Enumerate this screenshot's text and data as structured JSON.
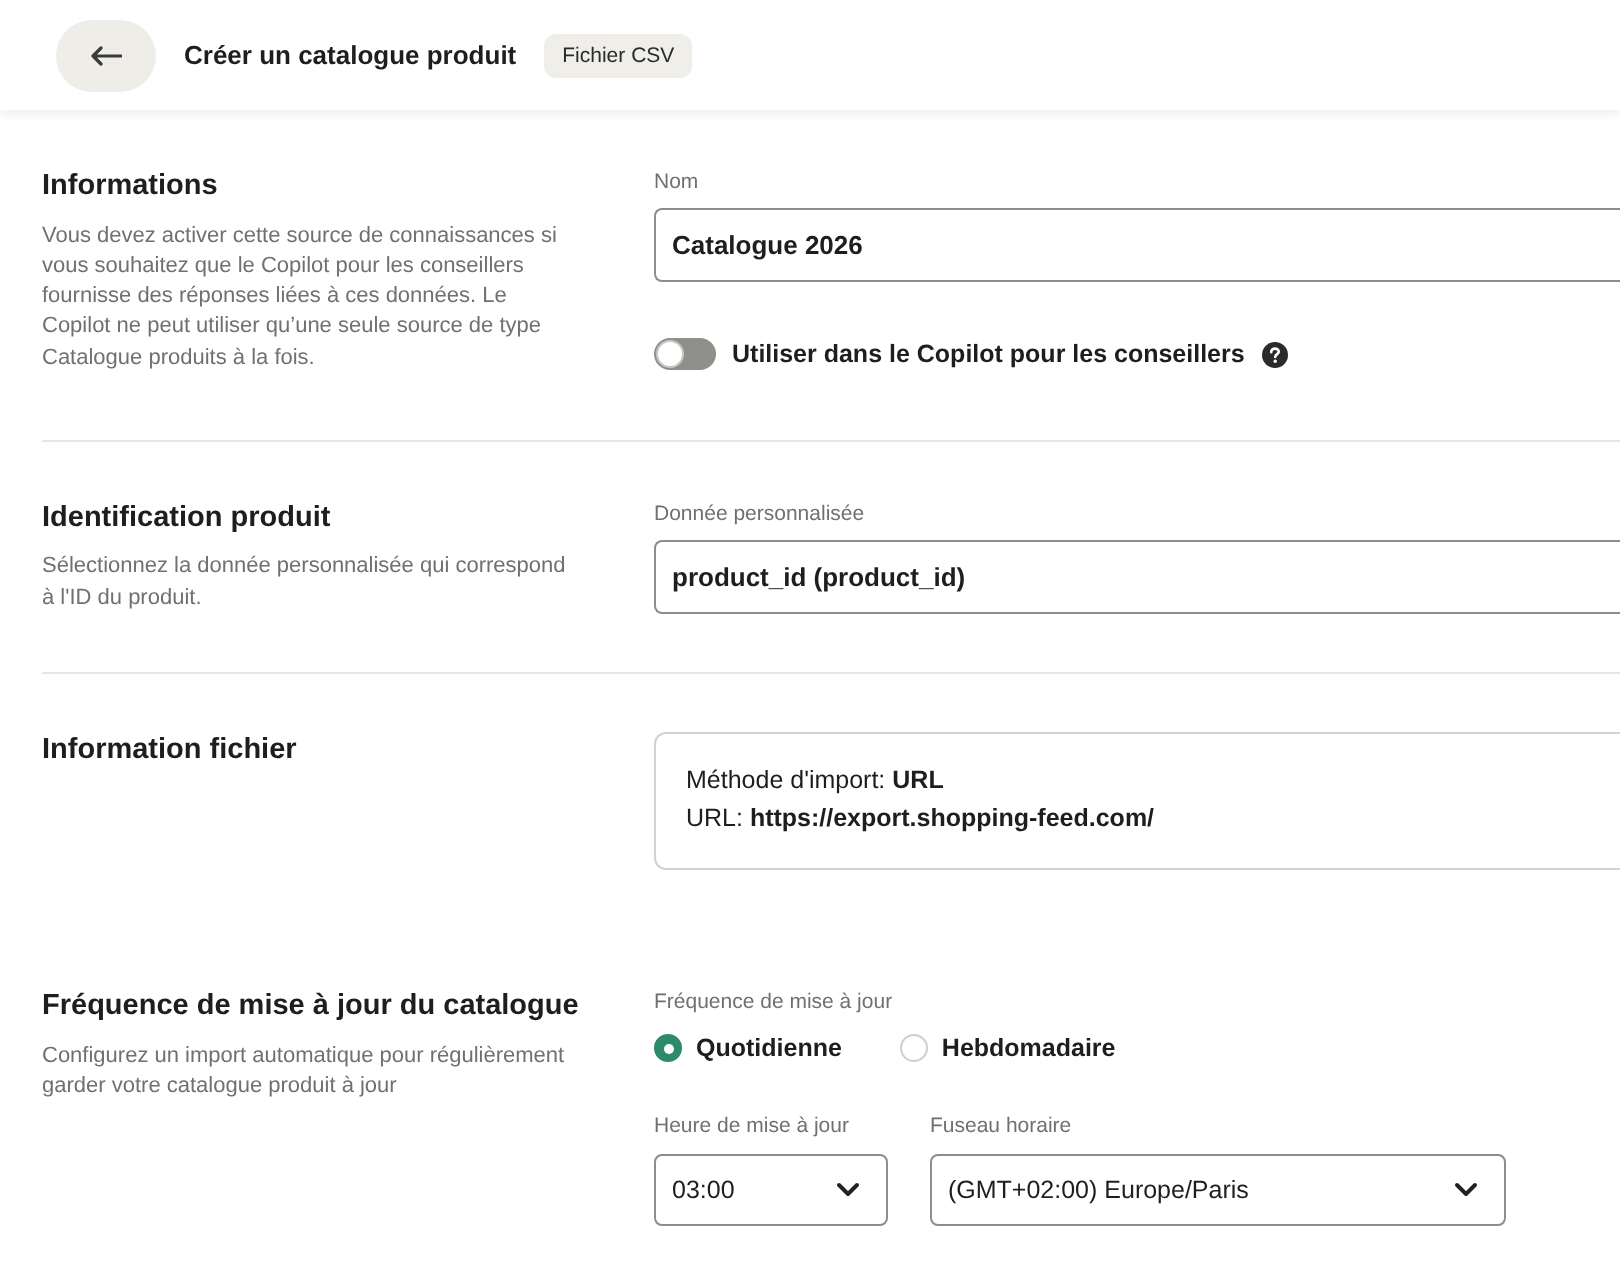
{
  "header": {
    "title": "Créer un catalogue produit",
    "tag": "Fichier CSV"
  },
  "sections": [
    {
      "kind": "form",
      "title": "Informations",
      "description": "Vous devez activer cette source de connaissances si vous souhaitez que le Copilot pour les conseillers fournisse des réponses liées à ces données. Le Copilot ne peut utiliser qu’une seule source de type Catalogue produits à la fois.",
      "divider": true,
      "field": {
        "label": "Nom",
        "value": "Catalogue 2026"
      },
      "toggle": {
        "label": "Utiliser dans le Copilot pour les conseillers",
        "on": false
      }
    },
    {
      "kind": "form",
      "title": "Identification produit",
      "description": "Sélectionnez la donnée personnalisée qui correspond à l'ID du produit.",
      "divider": true,
      "field": {
        "label": "Donnée personnalisée",
        "value": "product_id (product_id)"
      }
    },
    {
      "kind": "info",
      "title": "Information fichier",
      "divider": false,
      "lines": [
        "Méthode d'import: **URL**",
        "URL: **https://export.shopping-feed.com/**"
      ]
    },
    {
      "kind": "schedule",
      "title": "Fréquence de mise à jour du catalogue",
      "description": "Configurez un import automatique pour régulièrement garder votre catalogue produit à jour",
      "divider": false,
      "frequency": {
        "label": "Fréquence de mise à jour",
        "options": [
          {
            "label": "Quotidienne",
            "selected": true
          },
          {
            "label": "Hebdomadaire",
            "selected": false
          }
        ]
      },
      "selects": [
        {
          "label": "Heure de mise à jour",
          "value": "03:00"
        },
        {
          "label": "Fuseau horaire",
          "value": "(GMT+02:00) Europe/Paris"
        }
      ]
    }
  ]
}
